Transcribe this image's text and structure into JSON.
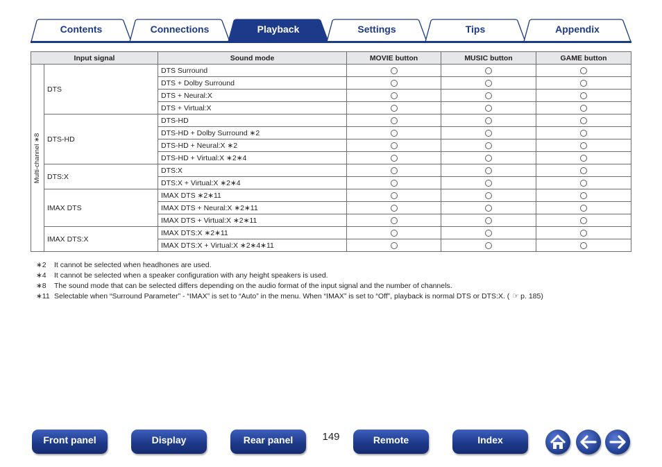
{
  "tabs": [
    {
      "label": "Contents",
      "active": false
    },
    {
      "label": "Connections",
      "active": false
    },
    {
      "label": "Playback",
      "active": true
    },
    {
      "label": "Settings",
      "active": false
    },
    {
      "label": "Tips",
      "active": false
    },
    {
      "label": "Appendix",
      "active": false
    }
  ],
  "table": {
    "headers": {
      "input_signal": "Input signal",
      "sound_mode": "Sound mode",
      "movie": "MOVIE button",
      "music": "MUSIC button",
      "game": "GAME button"
    },
    "group_label": "Multi-channel ∗8",
    "available_mark": "○",
    "signals": [
      {
        "name": "DTS",
        "modes": [
          "DTS Surround",
          "DTS + Dolby Surround",
          "DTS + Neural:X",
          "DTS + Virtual:X"
        ]
      },
      {
        "name": "DTS-HD",
        "modes": [
          "DTS-HD",
          "DTS-HD + Dolby Surround ∗2",
          "DTS-HD + Neural:X ∗2",
          "DTS-HD + Virtual:X ∗2∗4"
        ]
      },
      {
        "name": "DTS:X",
        "modes": [
          "DTS:X",
          "DTS:X + Virtual:X ∗2∗4"
        ]
      },
      {
        "name": "IMAX DTS",
        "modes": [
          "IMAX DTS ∗2∗11",
          "IMAX DTS + Neural:X ∗2∗11",
          "IMAX DTS + Virtual:X ∗2∗11"
        ]
      },
      {
        "name": "IMAX DTS:X",
        "modes": [
          "IMAX DTS:X ∗2∗11",
          "IMAX DTS:X + Virtual:X ∗2∗4∗11"
        ]
      }
    ]
  },
  "notes": [
    {
      "mark": "∗2",
      "text": "It cannot be selected when headhones are used."
    },
    {
      "mark": "∗4",
      "text": "It cannot be selected when a speaker configuration with any height speakers is used."
    },
    {
      "mark": "∗8",
      "text": "The sound mode that can be selected differs depending on the audio format of the input signal and the number of channels."
    },
    {
      "mark": "∗11",
      "text": "Selectable when “Surround Parameter” - “IMAX” is set to “Auto” in the menu. When “IMAX” is set to “Off”, playback is normal DTS or DTS:X.  (",
      "ref_text": "p. 185)"
    }
  ],
  "bottom_nav": {
    "front_panel": "Front panel",
    "display": "Display",
    "rear_panel": "Rear panel",
    "page_number": "149",
    "remote": "Remote",
    "index": "Index"
  },
  "icons": {
    "home": "home-icon",
    "back": "arrow-left-icon",
    "forward": "arrow-right-icon",
    "page_ref": "pointing-hand-icon"
  },
  "colors": {
    "brand": "#1d3a8a",
    "header_bg": "#e6e7e8"
  }
}
